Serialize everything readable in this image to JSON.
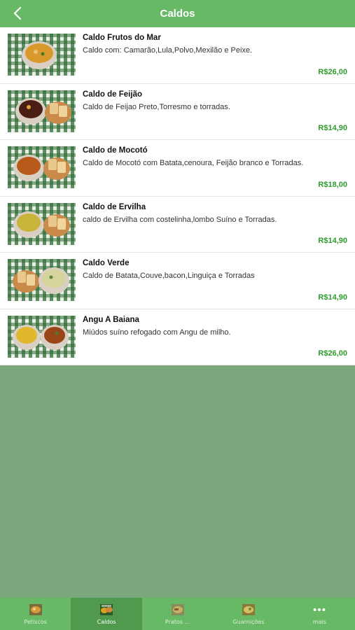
{
  "header": {
    "title": "Caldos",
    "back_icon": "chevron-left-icon"
  },
  "colors": {
    "nav_green": "#67b965",
    "active_tab": "#4f9a4e",
    "price_green": "#2e9a2e",
    "empty_background": "#7aa87c"
  },
  "items": [
    {
      "name": "Caldo Frutos do Mar",
      "description": "Caldo com: Camarão,Lula,Polvo,Mexilão e Peixe.",
      "price": "R$26,00"
    },
    {
      "name": "Caldo de Feijão",
      "description": "Caldo de Feijao Preto,Torresmo e torradas.",
      "price": "R$14,90"
    },
    {
      "name": "Caldo de Mocotó",
      "description": "Caldo de Mocotó com Batata,cenoura, Feijão branco e Torradas.",
      "price": "R$18,00"
    },
    {
      "name": "Caldo de Ervilha",
      "description": "caldo de Ervilha com costelinha,lombo Suíno e Torradas.",
      "price": "R$14,90"
    },
    {
      "name": "Caldo Verde",
      "description": "Caldo de Batata,Couve,bacon,Linguiça e Torradas",
      "price": "R$14,90"
    },
    {
      "name": "Angu A Baiana",
      "description": "Miúdos suíno refogado com Angu de milho.",
      "price": "R$26,00"
    }
  ],
  "tabs": [
    {
      "label": "Petiscos",
      "icon": "petiscos-food-icon",
      "active": false
    },
    {
      "label": "Caldos",
      "icon": "caldos-food-icon",
      "active": true
    },
    {
      "label": "Pratos ...",
      "icon": "pratos-food-icon",
      "active": false
    },
    {
      "label": "Guarnições",
      "icon": "guarnicoes-food-icon",
      "active": false
    },
    {
      "label": "mais",
      "icon": "more-dots-icon",
      "active": false
    }
  ]
}
